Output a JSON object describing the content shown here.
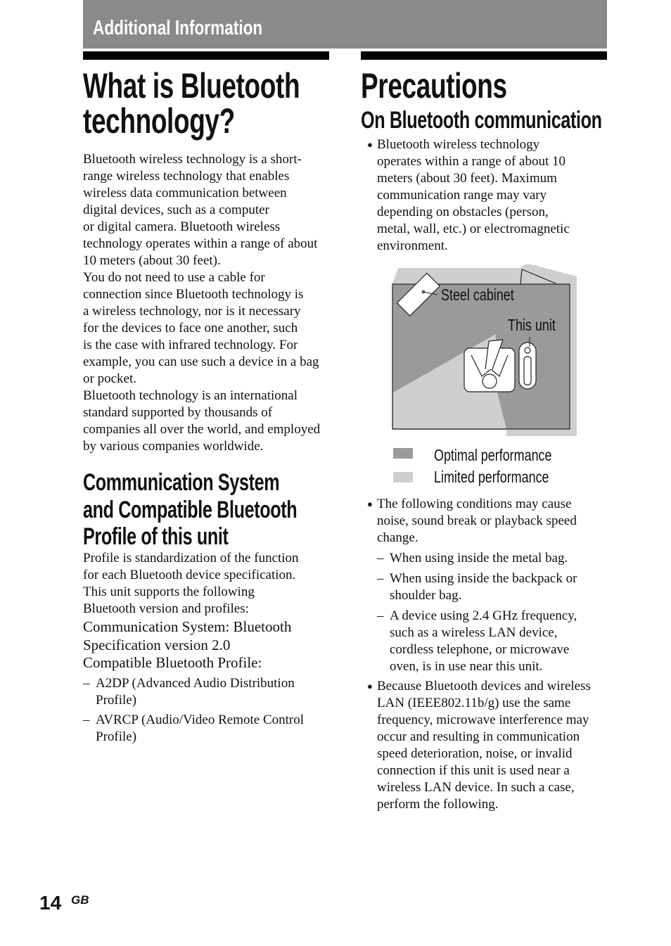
{
  "header": {
    "section_title": "Additional Information",
    "bar_color": "#898a8c"
  },
  "left": {
    "title_lines": [
      "What is Bluetooth",
      "technology?"
    ],
    "intro_lines": [
      "Bluetooth wireless technology is a short-",
      "range wireless technology that enables",
      "wireless data communication between",
      "digital devices, such as a computer",
      "or digital camera. Bluetooth wireless",
      "technology operates within a range of about",
      "10 meters (about 30 feet).",
      "You do not need to use a cable for",
      "connection since Bluetooth technology is",
      "a wireless technology, nor is it necessary",
      "for the devices to face one another, such",
      "is the case with infrared technology. For",
      "example, you can use such a device in a bag",
      "or pocket.",
      "Bluetooth technology is an international",
      "standard supported by thousands of",
      "companies all over the world, and employed",
      "by various companies worldwide."
    ],
    "section2_title_lines": [
      "Communication System",
      "and Compatible Bluetooth",
      "Profile of this unit"
    ],
    "section2_lines": [
      "Profile is standardization of the function",
      "for each Bluetooth device specification.",
      "This unit supports the following",
      "Bluetooth version and profiles:"
    ],
    "section2_spec_lines": [
      "Communication System: Bluetooth",
      "Specification version 2.0",
      "Compatible Bluetooth Profile:"
    ],
    "profiles": [
      {
        "marker": "–",
        "lines": [
          "A2DP (Advanced Audio Distribution",
          "Profile)"
        ]
      },
      {
        "marker": "–",
        "lines": [
          "AVRCP (Audio/Video Remote Control",
          "Profile)"
        ]
      }
    ]
  },
  "right": {
    "title": "Precautions",
    "subtitle": "On Bluetooth communication",
    "bullet1": {
      "marker": "●",
      "lines": [
        "Bluetooth wireless technology",
        "operates within a range of about 10",
        "meters (about 30 feet). Maximum",
        "communication range may vary",
        "depending on obstacles (person,",
        "metal, wall, etc.) or electromagnetic",
        "environment."
      ]
    },
    "diagram": {
      "steel_cabinet_label": "Steel cabinet",
      "this_unit_label": "This unit",
      "optimal_color": "#9a9a9a",
      "limited_color": "#cfcfcf"
    },
    "legend": [
      {
        "label": "Optimal performance",
        "color": "#9a9a9a"
      },
      {
        "label": "Limited performance",
        "color": "#cfcfcf"
      }
    ],
    "bullet2": {
      "marker": "●",
      "lines": [
        "The following conditions may cause",
        "noise, sound break or playback speed",
        "change."
      ]
    },
    "conditions": [
      {
        "marker": "–",
        "lines": [
          "When using inside the metal bag."
        ]
      },
      {
        "marker": "–",
        "lines": [
          "When using inside the backpack or",
          "shoulder bag."
        ]
      },
      {
        "marker": "–",
        "lines": [
          "A device using 2.4 GHz frequency,",
          "such as a wireless LAN device,",
          "cordless telephone, or microwave",
          "oven, is in use near this unit."
        ]
      }
    ],
    "bullet3": {
      "marker": "●",
      "lines": [
        "Because Bluetooth devices and wireless",
        "LAN (IEEE802.11b/g) use the same",
        "frequency, microwave interference may",
        "occur and resulting in communication",
        "speed deterioration, noise, or invalid",
        "connection if this unit is used near a",
        "wireless LAN device. In such a case,",
        "perform the following."
      ]
    }
  },
  "footer": {
    "page_number": "14",
    "region": "GB"
  }
}
